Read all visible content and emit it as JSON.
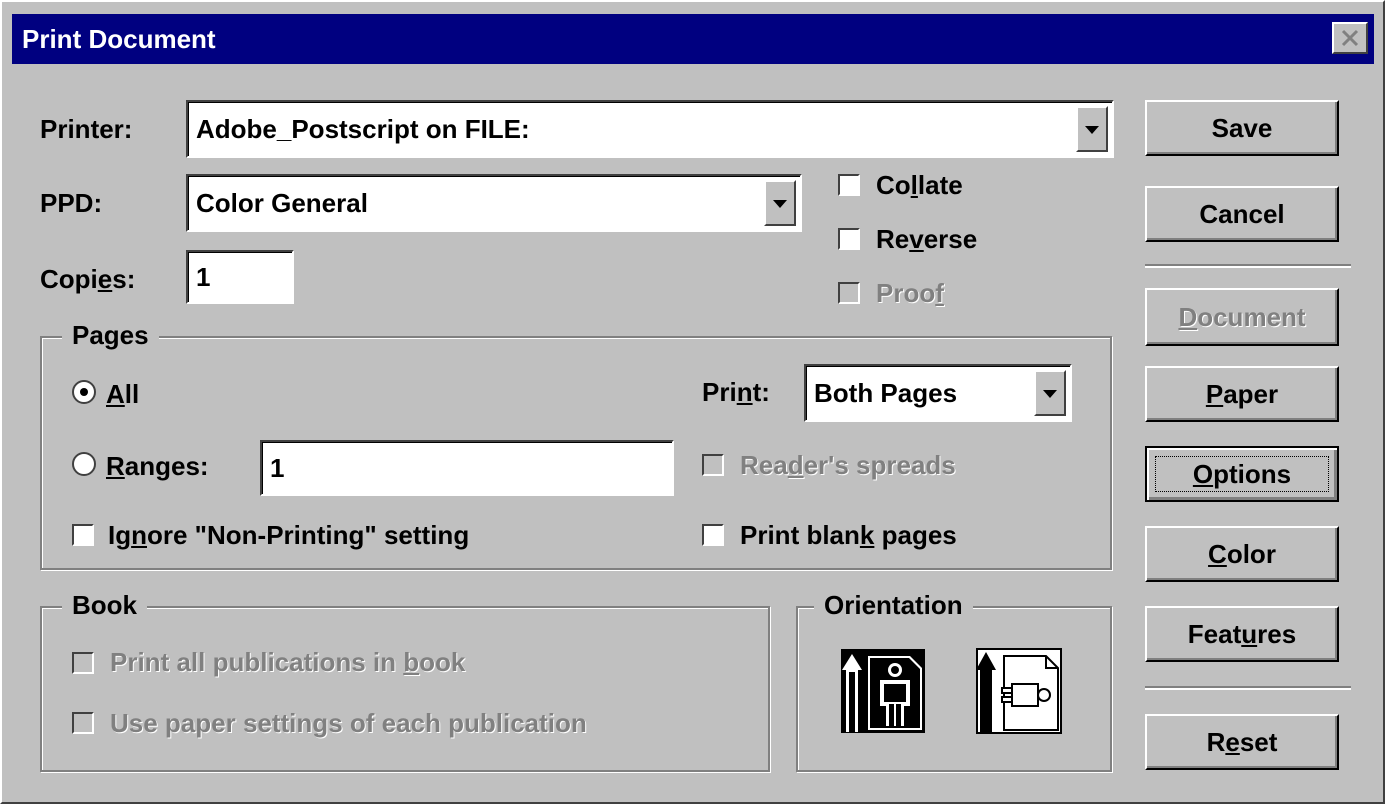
{
  "window": {
    "title": "Print Document"
  },
  "printer": {
    "label": "Printer:",
    "value": "Adobe_Postscript on FILE:"
  },
  "ppd": {
    "label": "PPD:",
    "value": "Color General"
  },
  "copies": {
    "label_pre": "Copi",
    "label_u": "e",
    "label_post": "s:",
    "value": "1"
  },
  "options_checks": {
    "collate": {
      "pre": "Co",
      "u": "l",
      "post": "late",
      "checked": false,
      "enabled": true
    },
    "reverse": {
      "pre": "Re",
      "u": "v",
      "post": "erse",
      "checked": false,
      "enabled": true
    },
    "proof": {
      "pre": "Proo",
      "u": "f",
      "post": "",
      "checked": false,
      "enabled": false
    }
  },
  "pages": {
    "title": "Pages",
    "all": {
      "u": "A",
      "post": "ll",
      "selected": true
    },
    "ranges": {
      "u": "R",
      "post": "anges:",
      "value": "1",
      "selected": false
    },
    "print_label": {
      "pre": "Pri",
      "u": "n",
      "post": "t:"
    },
    "print_value": "Both Pages",
    "readers_spreads": {
      "pre": "Rea",
      "u": "d",
      "post": "er's spreads",
      "enabled": false
    },
    "ignore_nonprinting": {
      "pre": "Ig",
      "u": "n",
      "post": "ore \"Non-Printing\" setting",
      "checked": false
    },
    "print_blank": {
      "pre": "Print blan",
      "u": "k",
      "post": " pages",
      "checked": false
    }
  },
  "book": {
    "title": "Book",
    "print_all": {
      "pre": "Print all publications in ",
      "u": "b",
      "post": "ook",
      "enabled": false
    },
    "use_paper": {
      "pre": "Use paper settin",
      "u": "g",
      "post": "s of each publication",
      "enabled": false
    }
  },
  "orientation": {
    "title": "Orientation",
    "selected": "portrait"
  },
  "buttons": {
    "save": "Save",
    "cancel": "Cancel",
    "document": {
      "u": "D",
      "post": "ocument",
      "enabled": false
    },
    "paper": {
      "u": "P",
      "post": "aper"
    },
    "options": {
      "u": "O",
      "post": "ptions"
    },
    "color": {
      "u": "C",
      "post": "olor"
    },
    "features": {
      "pre": "Feat",
      "u": "u",
      "post": "res"
    },
    "reset": {
      "pre": "R",
      "u": "e",
      "post": "set"
    }
  }
}
